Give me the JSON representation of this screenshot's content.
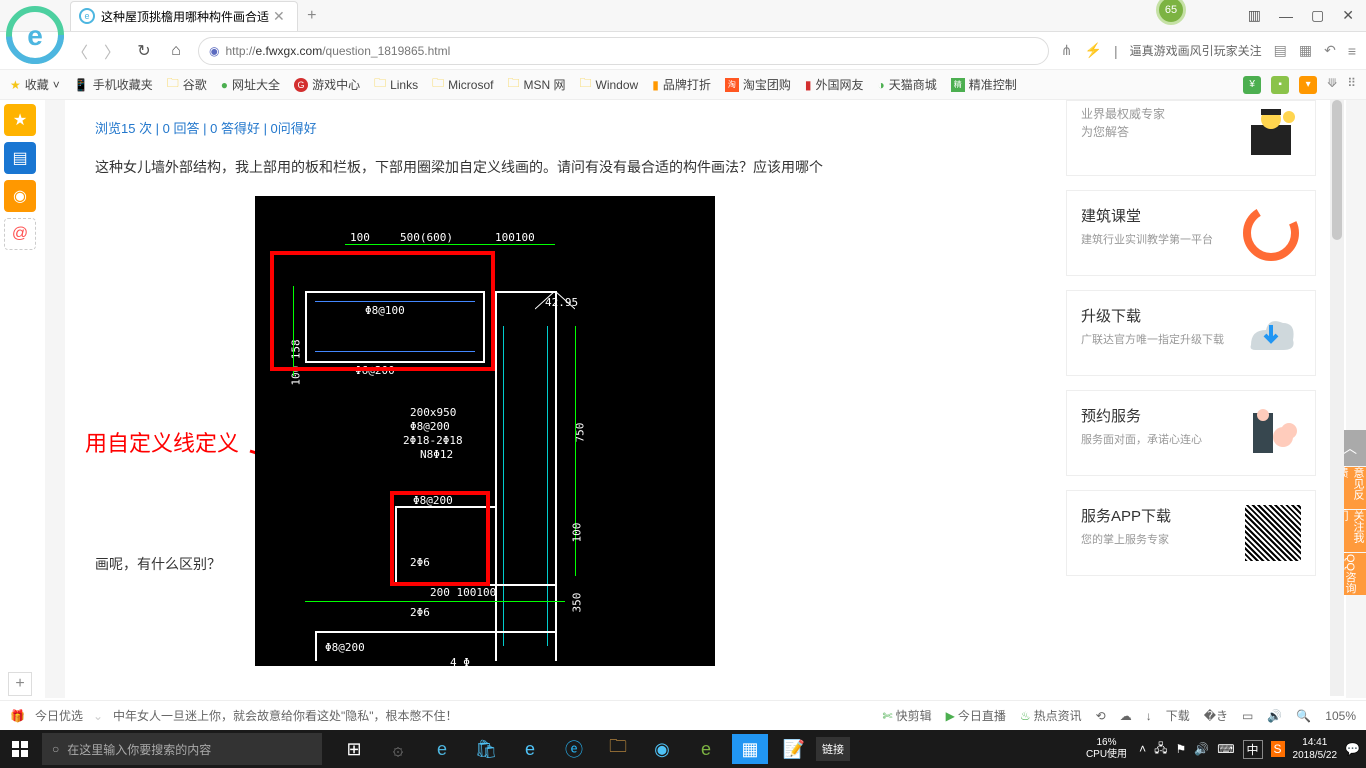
{
  "window": {
    "badge": "65",
    "controls": [
      "☰",
      "—",
      "▢",
      "✕"
    ]
  },
  "tab": {
    "title": "这种屋顶挑檐用哪种构件画合适"
  },
  "nav": {
    "url_prefix": "http://",
    "url_host": "e.fwxgx.com",
    "url_path": "/question_1819865.html",
    "headline": "逼真游戏画风引玩家关注"
  },
  "bookmarks": {
    "fav": "收藏",
    "items": [
      "手机收藏夹",
      "谷歌",
      "网址大全",
      "游戏中心",
      "Links",
      "Microsof",
      "MSN 网",
      "Window",
      "品牌打折",
      "淘宝团购",
      "外国网友",
      "天猫商城",
      "精准控制"
    ]
  },
  "page": {
    "stats": "浏览15 次 | 0 回答 | 0 答得好 | 0问得好",
    "question": "这种女儿墙外部结构，我上部用的板和栏板，下部用圈梁加自定义线画的。请问有没有最合适的构件画法？应该用哪个",
    "annotation": "用自定义线定义",
    "followup": "画呢，有什么区别？"
  },
  "cad": {
    "t_top1": "100",
    "t_top2": "500(600)",
    "t_top3": "100100",
    "t_158": "100 158",
    "t_phi8_100": "Φ8@100",
    "t_phi6_200": "Φ6@200",
    "t_4295": "42.95",
    "t_200x950": "200x950",
    "t_phi8_200a": "Φ8@200",
    "t_2phi18": "2Φ18-2Φ18",
    "t_n8phi12": "N8Φ12",
    "t_750": "750",
    "t_phi8_200b": "Φ8@200",
    "t_2phi6": "2Φ6",
    "t_100": "100",
    "t_350": "350",
    "t_200_100100": "200   100100",
    "t_2phi6b": "2Φ6",
    "t_phi8_200c": "Φ8@200",
    "t_4phi": "4 Φ"
  },
  "sidebar": {
    "cards": [
      {
        "title": "",
        "sub": "业界最权威专家\n为您解答"
      },
      {
        "title": "建筑课堂",
        "sub": "建筑行业实训教学第一平台"
      },
      {
        "title": "升级下载",
        "sub": "广联达官方唯一指定升级下载"
      },
      {
        "title": "预约服务",
        "sub": "服务面对面，承诺心连心"
      },
      {
        "title": "服务APP下载",
        "sub": "您的掌上服务专家"
      }
    ],
    "float": [
      "意见反馈",
      "关注我们",
      "QQ咨询"
    ]
  },
  "infobar": {
    "left1": "今日优选",
    "news": "中年女人一旦迷上你，就会故意给你看这处\"隐私\"，根本憋不住！",
    "right": [
      "快剪辑",
      "今日直播",
      "热点资讯"
    ],
    "dl": "下载",
    "zoom": "105%"
  },
  "taskbar": {
    "search_ph": "在这里输入你要搜索的内容",
    "link": "链接",
    "cpu1": "16%",
    "cpu2": "CPU使用",
    "time": "14:41",
    "date": "2018/5/22",
    "ime": "中"
  }
}
